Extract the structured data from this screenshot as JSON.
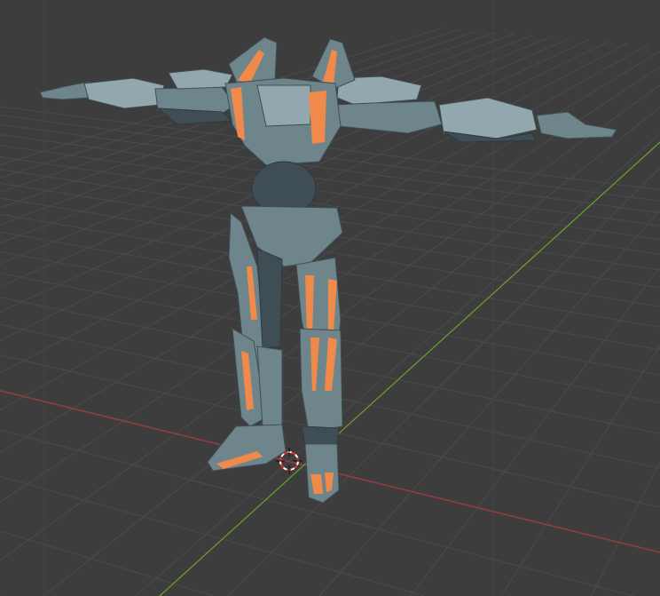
{
  "viewport": {
    "background_color": "#3d3d3d",
    "grid_color": "#4b4b4b",
    "x_axis_color": "#a0393f",
    "y_axis_color": "#6a9a2c",
    "cursor_icon": "3d-cursor-icon"
  },
  "model": {
    "body_color": "#6f858c",
    "body_shadow_color": "#3f4e55",
    "body_highlight_color": "#93a8ae",
    "accent_color": "#f08a4b"
  }
}
